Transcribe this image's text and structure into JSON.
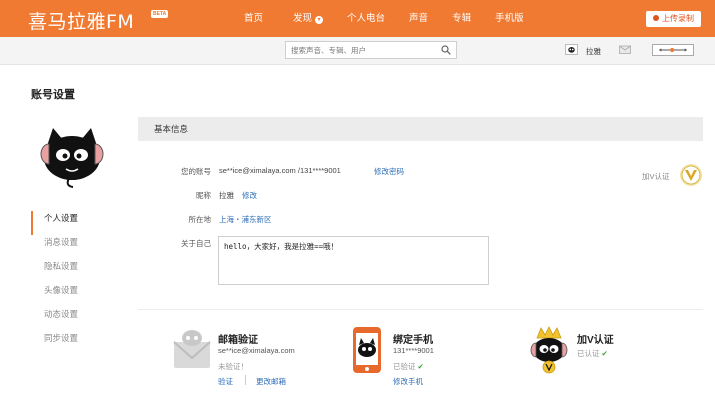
{
  "header": {
    "logo": "喜马拉雅FM",
    "beta": "BETA",
    "nav": [
      "首页",
      "发现",
      "个人电台",
      "声音",
      "专辑",
      "手机版"
    ],
    "upload_label": "上传录制"
  },
  "search": {
    "placeholder": "搜索声音、专辑、用户"
  },
  "user": {
    "name": "拉雅"
  },
  "page": {
    "title": "账号设置",
    "menu": [
      "个人设置",
      "消息设置",
      "隐私设置",
      "头像设置",
      "动态设置",
      "同步设置"
    ],
    "active_menu": "个人设置"
  },
  "basic": {
    "section_title": "基本信息",
    "account_label": "您的账号",
    "account_value": "se**ice@ximalaya.com /131****9001",
    "change_password": "修改密码",
    "nickname_label": "昵称",
    "nickname_value": "拉雅",
    "nickname_edit": "修改",
    "location_label": "所在地",
    "location_value": "上海・浦东新区",
    "about_label": "关于自己",
    "about_value": "hello，大家好，我是拉雅==哦！",
    "v_label": "加V认证"
  },
  "cards": {
    "email": {
      "title": "邮箱验证",
      "value": "se**ice@ximalaya.com",
      "status": "未验证！",
      "action1": "验证",
      "action2": "更改邮箱"
    },
    "phone": {
      "title": "绑定手机",
      "value": "131****9001",
      "status": "已验证",
      "action": "修改手机"
    },
    "vip": {
      "title": "加V认证",
      "status": "已认证"
    }
  },
  "colors": {
    "brand": "#f07a32",
    "link": "#2e6eb8",
    "check": "#3aa53a"
  }
}
